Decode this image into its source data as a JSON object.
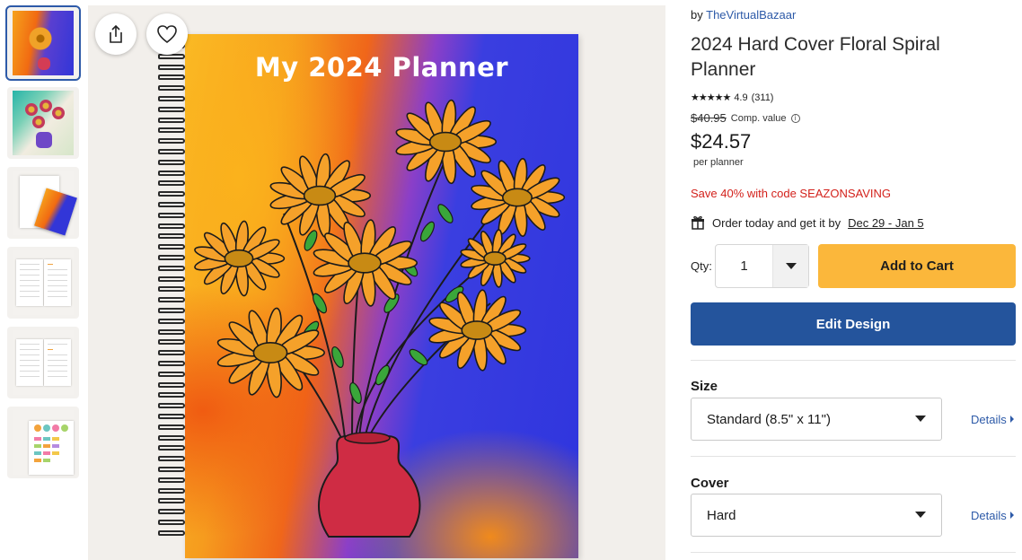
{
  "thumbnails": [
    {
      "name": "Cover front view",
      "active": true
    },
    {
      "name": "Floral artwork",
      "active": false
    },
    {
      "name": "Planner angled view",
      "active": false
    },
    {
      "name": "Inside pages",
      "active": false
    },
    {
      "name": "Inside pages spread",
      "active": false
    },
    {
      "name": "Sticker sheet",
      "active": false
    }
  ],
  "preview": {
    "cover_title": "My 2024 Planner",
    "share_icon": "share-icon",
    "favorite_icon": "heart-icon"
  },
  "product": {
    "by_prefix": "by",
    "seller": "TheVirtualBazaar",
    "title": "2024 Hard Cover Floral Spiral Planner",
    "stars": "★★★★★",
    "rating": "4.9",
    "review_count": "(311)",
    "comp_price": "$40.95",
    "comp_label": "Comp. value",
    "info_icon": "i",
    "price": "$24.57",
    "price_unit": "per planner",
    "promo": "Save 40% with code SEAZONSAVING",
    "delivery_prefix": "Order today and get it by",
    "delivery_range": "Dec 29 - Jan 5"
  },
  "purchase": {
    "qty_label": "Qty:",
    "qty_value": "1",
    "add_to_cart": "Add to Cart",
    "edit_design": "Edit Design"
  },
  "options": {
    "size_label": "Size",
    "size_value": "Standard (8.5\" x 11\")",
    "cover_label": "Cover",
    "cover_value": "Hard",
    "details_label": "Details"
  },
  "colors": {
    "accent_blue": "#24549c",
    "cart_yellow": "#fbb73b",
    "promo_red": "#d3221c",
    "link_blue": "#2d5aa8"
  }
}
